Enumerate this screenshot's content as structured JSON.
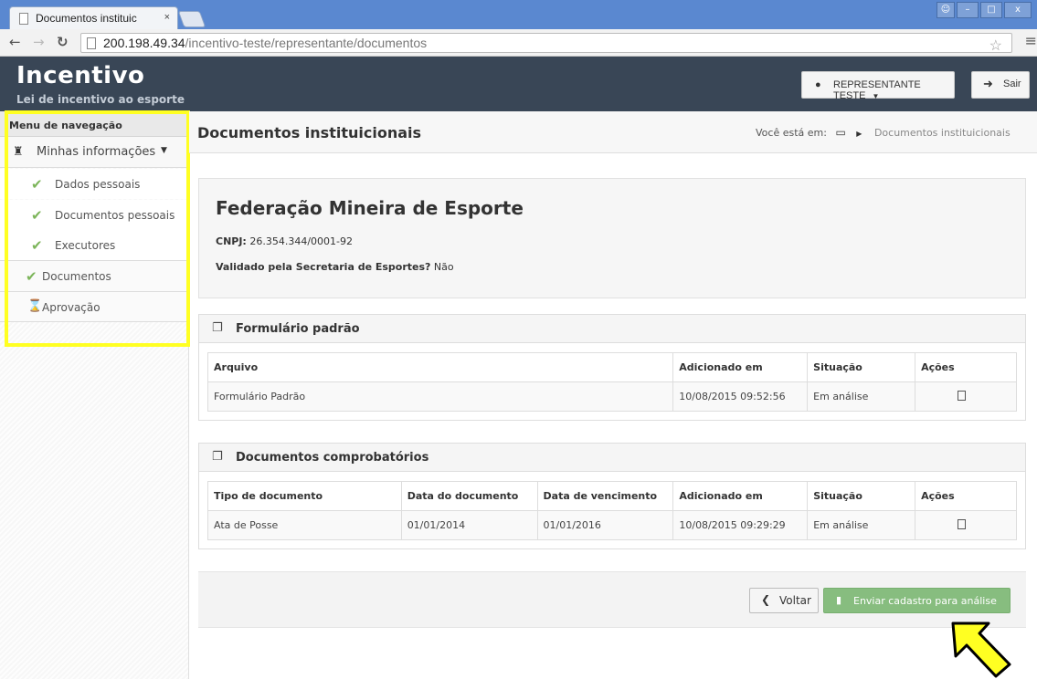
{
  "browser": {
    "tab_title": "Documentos instituic",
    "tab_close": "×",
    "url_host": "200.198.49.34",
    "url_path": "/incentivo-teste/representante/documentos"
  },
  "app": {
    "brand": "Incentivo",
    "subtitle": "Lei de incentivo ao esporte",
    "user_button": "REPRESENTANTE TESTE",
    "logout_button": "Sair"
  },
  "sidebar": {
    "title": "Menu de navegação",
    "parent": "Minhas informações",
    "sub_items": [
      {
        "label": "Dados pessoais",
        "status": "done"
      },
      {
        "label": "Documentos pessoais",
        "status": "done"
      },
      {
        "label": "Executores",
        "status": "done"
      }
    ],
    "main_items": [
      {
        "label": "Documentos",
        "status": "done"
      },
      {
        "label": "Aprovação",
        "status": "pending"
      }
    ]
  },
  "page": {
    "title": "Documentos instituicionais",
    "breadcrumb_prefix": "Você está em:",
    "breadcrumb_last": "Documentos instituicionais"
  },
  "organization": {
    "name": "Federação Mineira de Esporte",
    "cnpj_label": "CNPJ:",
    "cnpj": " 26.354.344/0001-92",
    "validated_label": "Validado pela Secretaria de Esportes?",
    "validated": " Não"
  },
  "form_panel": {
    "title": "Formulário padrão",
    "headers": [
      "Arquivo",
      "Adicionado em",
      "Situação",
      "Ações"
    ],
    "rows": [
      {
        "arquivo": "Formulário Padrão",
        "adicionado": "10/08/2015 09:52:56",
        "situacao": "Em análise"
      }
    ]
  },
  "docs_panel": {
    "title": "Documentos comprobatórios",
    "headers": [
      "Tipo de documento",
      "Data do documento",
      "Data de vencimento",
      "Adicionado em",
      "Situação",
      "Ações"
    ],
    "rows": [
      {
        "tipo": "Ata de Posse",
        "data_doc": "01/01/2014",
        "vencimento": "01/01/2016",
        "adicionado": "10/08/2015 09:29:29",
        "situacao": "Em análise"
      }
    ]
  },
  "actions": {
    "back": "Voltar",
    "submit": "Enviar cadastro para análise"
  },
  "colors": {
    "header_bg": "#394656",
    "highlight": "#ffff22",
    "success": "#87bd7f",
    "check": "#7cb55a"
  }
}
